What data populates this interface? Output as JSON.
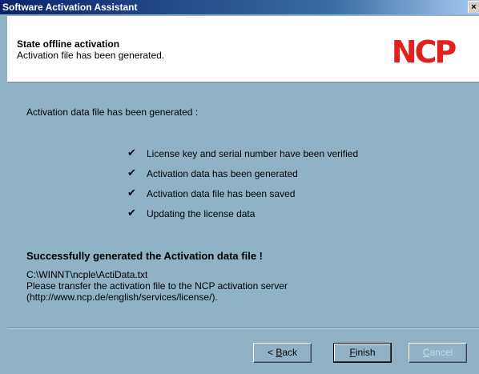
{
  "window": {
    "title": "Software Activation Assistant",
    "close_glyph": "×"
  },
  "header": {
    "title": "State offline activation",
    "subtitle": "Activation file has been generated.",
    "logo_text": "NCP",
    "logo_color": "#e2211c"
  },
  "body": {
    "intro": "Activation data file has been generated :",
    "checklist": [
      {
        "icon": "checkmark-icon",
        "label": "License key and serial number have been verified"
      },
      {
        "icon": "checkmark-icon",
        "label": "Activation data has been generated"
      },
      {
        "icon": "checkmark-icon",
        "label": "Activation data file has been saved"
      },
      {
        "icon": "checkmark-icon",
        "label": "Updating the license data"
      }
    ],
    "result_title": "Successfully generated the Activation data file !",
    "file_path": "C:\\WINNT\\ncple\\ActiData.txt",
    "transfer_note": "Please transfer the activation file to the NCP activation server",
    "server_url": "(http://www.ncp.de/english/services/license/)."
  },
  "buttons": {
    "back_prefix": "< ",
    "back_accel": "B",
    "back_rest": "ack",
    "finish_accel": "F",
    "finish_rest": "inish",
    "cancel_accel": "C",
    "cancel_rest": "ancel"
  },
  "colors": {
    "panel": "#8fb3c4",
    "titlebar": "#0a246a",
    "disabled_text": "#c9dde6"
  }
}
